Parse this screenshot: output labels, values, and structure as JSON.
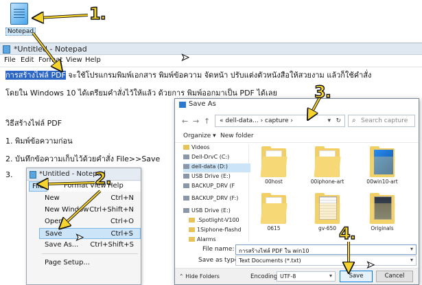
{
  "desktop": {
    "icon_label": "Notepad"
  },
  "steps": [
    "1.",
    "2.",
    "3.",
    "4."
  ],
  "notepad": {
    "title": "*Untitled - Notepad",
    "menu": [
      "File",
      "Edit",
      "Format",
      "View",
      "Help"
    ],
    "lines": {
      "line1_selected": "การสร้างไฟล์ PDF",
      "line1_rest": " จะใช้โปรแกรมพิมพ์เอกสาร พิมพ์ข้อความ จัดหน้า ปรับแต่งตัวหนังสือให้สวยงาม แล้วก็ใช้คำสั่ง",
      "line2": "โดยใน Windows 10 ได้เตรียมคำสั่งไว้ให้แล้ว ด้วยการ พิมพ์ออกมาเป็น PDF ได้เลย",
      "line3": "วิธีสร้างไฟล์ PDF",
      "line4": "1. พิมพ์ข้อความก่อน",
      "line5": "2. บันทึกข้อความเก็บไว้ด้วยคำสั่ง File>>Save",
      "line6": "3."
    }
  },
  "file_menu": {
    "title": "*Untitled - Notepad",
    "menubar": [
      "File",
      "Format",
      "View",
      "Help"
    ],
    "items": [
      {
        "label": "New",
        "shortcut": "Ctrl+N"
      },
      {
        "label": "New Window",
        "shortcut": "Ctrl+Shift+N"
      },
      {
        "label": "Open...",
        "shortcut": "Ctrl+O"
      },
      {
        "label": "Save",
        "shortcut": "Ctrl+S"
      },
      {
        "label": "Save As...",
        "shortcut": "Ctrl+Shift+S"
      },
      {
        "label": "Page Setup...",
        "shortcut": ""
      }
    ],
    "highlighted": "Save"
  },
  "save_dialog": {
    "title": "Save As",
    "nav": {
      "back": "←",
      "forward": "→",
      "up": "↑"
    },
    "address": "« dell-data... › capture ›",
    "search_placeholder": "Search capture",
    "commands": {
      "organize": "Organize ▾",
      "new_folder": "New folder"
    },
    "tree": [
      {
        "label": "Videos",
        "icon": "folder"
      },
      {
        "label": "Dell-DrvC (C:)",
        "icon": "drive"
      },
      {
        "label": "dell-data (D:)",
        "icon": "drive",
        "selected": true
      },
      {
        "label": "USB Drive (E:)",
        "icon": "drive"
      },
      {
        "label": "BACKUP_DRV (F",
        "icon": "drive"
      },
      {
        "label": "BACKUP_DRV (F:)",
        "icon": "drive"
      },
      {
        "label": "USB Drive (E:)",
        "icon": "drive"
      },
      {
        "label": ".Spotlight-V100",
        "icon": "folder"
      },
      {
        "label": "1Siphone-flashd",
        "icon": "folder"
      },
      {
        "label": "Alarms",
        "icon": "folder"
      }
    ],
    "files": [
      {
        "name": "00host",
        "kind": "folder"
      },
      {
        "name": "00iphone-art",
        "kind": "folder"
      },
      {
        "name": "00win10-art",
        "kind": "blue"
      },
      {
        "name": "0615",
        "kind": "folder"
      },
      {
        "name": "gv-650",
        "kind": "grid"
      },
      {
        "name": "Originals",
        "kind": "photo"
      }
    ],
    "file_name_label": "File name:",
    "file_name": "การสร้างไฟล์ PDF ใน win10",
    "save_type_label": "Save as type:",
    "save_type": "Text Documents (*.txt)",
    "hide_folders": "Hide Folders",
    "encoding_label": "Encoding:",
    "encoding": "UTF-8",
    "save_button": "Save",
    "cancel_button": "Cancel"
  },
  "colors": {
    "badge": "#f6d32d",
    "selection": "#2b66c4",
    "menu_highlight": "#cce4f7"
  }
}
